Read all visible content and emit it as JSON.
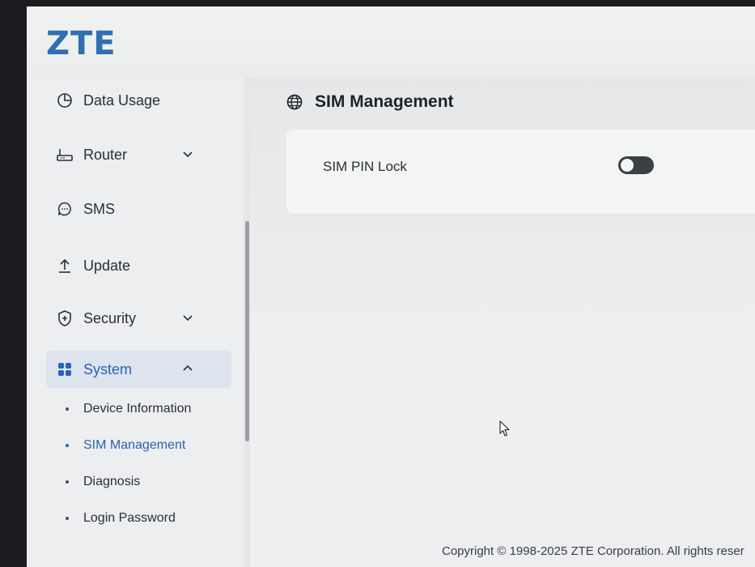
{
  "brand": {
    "logo_text": "ZTE",
    "color": "#2f6fb2"
  },
  "sidebar": {
    "items": [
      {
        "label": "Data Usage",
        "icon": "pie-chart-icon"
      },
      {
        "label": "Router",
        "icon": "router-icon",
        "expandable": true,
        "expanded": false
      },
      {
        "label": "SMS",
        "icon": "message-icon"
      },
      {
        "label": "Update",
        "icon": "upload-icon"
      },
      {
        "label": "Security",
        "icon": "shield-icon",
        "expandable": true,
        "expanded": false
      },
      {
        "label": "System",
        "icon": "grid-icon",
        "expandable": true,
        "expanded": true,
        "active": true
      }
    ],
    "system_subitems": [
      {
        "label": "Device Information"
      },
      {
        "label": "SIM Management",
        "active": true
      },
      {
        "label": "Diagnosis"
      },
      {
        "label": "Login Password"
      }
    ]
  },
  "main": {
    "title": "SIM Management",
    "title_icon": "globe-icon",
    "settings": [
      {
        "label": "SIM PIN Lock",
        "enabled": false
      }
    ]
  },
  "footer": {
    "copyright": "Copyright © 1998-2025 ZTE Corporation. All rights reser"
  },
  "colors": {
    "accent": "#2a63b7",
    "active_bg": "#dde4ee",
    "toggle_off": "#3c3f44"
  }
}
